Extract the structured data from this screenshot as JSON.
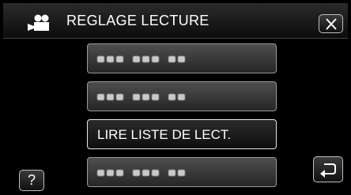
{
  "header": {
    "title": "REGLAGE LECTURE",
    "icon": "movie-camera-icon",
    "close_icon": "close-icon"
  },
  "menu": {
    "items": [
      {
        "label": "",
        "state": "blurred"
      },
      {
        "label": "",
        "state": "blurred"
      },
      {
        "label": "LIRE LISTE DE LECT.",
        "state": "selected"
      },
      {
        "label": "",
        "state": "blurred"
      }
    ]
  },
  "footer": {
    "help_label": "?",
    "back_icon": "return-arrow-icon"
  },
  "colors": {
    "background": "#000000",
    "button_border": "#9a9a9a",
    "text": "#ffffff"
  }
}
